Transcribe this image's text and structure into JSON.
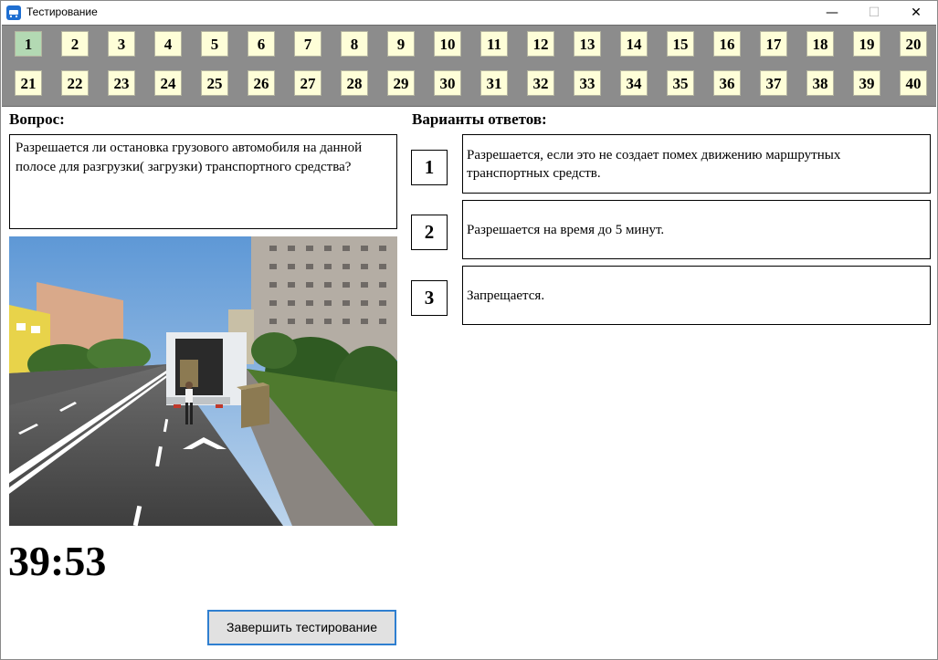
{
  "window": {
    "title": "Тестирование",
    "minimize_glyph": "—",
    "maximize_glyph": "☐",
    "close_glyph": "✕"
  },
  "questions": {
    "active": "1",
    "row1": [
      "1",
      "2",
      "3",
      "4",
      "5",
      "6",
      "7",
      "8",
      "9",
      "10",
      "11",
      "12",
      "13",
      "14",
      "15",
      "16",
      "17",
      "18",
      "19",
      "20"
    ],
    "row2": [
      "21",
      "22",
      "23",
      "24",
      "25",
      "26",
      "27",
      "28",
      "29",
      "30",
      "31",
      "32",
      "33",
      "34",
      "35",
      "36",
      "37",
      "38",
      "39",
      "40"
    ]
  },
  "question": {
    "label": "Вопрос:",
    "text": "Разрешается ли остановка грузового автомобиля на данной полосе для разгрузки( загрузки) транспортного средства?"
  },
  "answers": {
    "label": "Варианты ответов:",
    "items": [
      {
        "num": "1",
        "text": "Разрешается, если это не создает помех движению маршрутных транспортных средств."
      },
      {
        "num": "2",
        "text": "Разрешается на время до 5 минут."
      },
      {
        "num": "3",
        "text": "Запрещается."
      }
    ]
  },
  "timer": "39:53",
  "finish_button": "Завершить тестирование",
  "colors": {
    "panel": "#8c8c8c",
    "question_button": "#fefed8",
    "active_button": "#b3d9b3",
    "accent_border": "#2f7fd0"
  }
}
